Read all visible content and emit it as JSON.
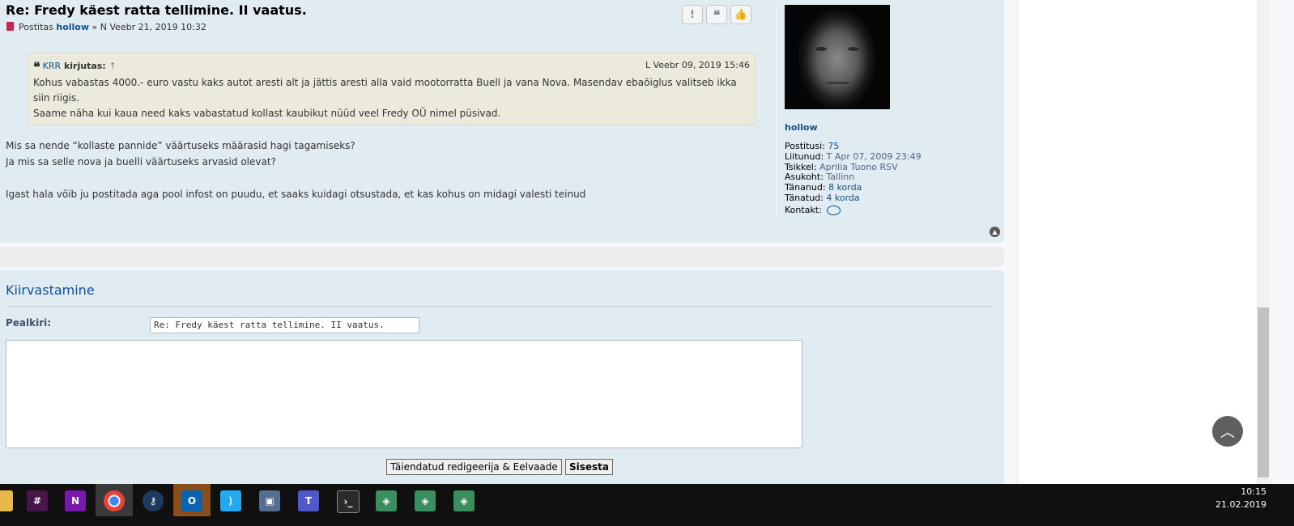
{
  "post": {
    "title": "Re: Fredy käest ratta tellimine. II vaatus.",
    "meta_prefix": "Postitas",
    "author": "hollow",
    "meta_suffix": "» N Veebr 21, 2019 10:32",
    "actions": [
      "!",
      "❝",
      "👍"
    ],
    "quote": {
      "author": "KRR",
      "written": "kirjutas:",
      "arrow": "↑",
      "date": "L Veebr 09, 2019 15:46",
      "line1": "Kohus vabastas 4000.- euro vastu kaks autot aresti alt ja jättis aresti alla vaid mootorratta Buell ja vana Nova. Masendav ebaõiglus valitseb ikka siin riigis.",
      "line2": "Saame näha kui kaua need kaks vabastatud kollast kaubikut nüüd veel Fredy OÜ nimel püsivad."
    },
    "body_line1": "Mis sa nende “kollaste pannide” väärtuseks määrasid hagi tagamiseks?",
    "body_line2": "Ja mis sa selle nova ja buelli väärtuseks arvasid olevat?",
    "body_line3": "Igast hala võib ju postitada aga pool infost on puudu, et saaks kuidagi otsustada, et kas kohus on midagi valesti teinud"
  },
  "profile": {
    "username": "hollow",
    "posts_label": "Postitusi:",
    "posts_value": "75",
    "joined_label": "Liitunud:",
    "joined_value": "T Apr 07, 2009 23:49",
    "bike_label": "Tsikkel:",
    "bike_value": "Aprilia Tuono RSV",
    "location_label": "Asukoht:",
    "location_value": "Tallinn",
    "thanked_label": "Tänanud:",
    "thanked_value": "8 korda",
    "been_thanked_label": "Tänatud:",
    "been_thanked_value": "4 korda",
    "contact_label": "Kontakt:"
  },
  "reply": {
    "title": "Kiirvastamine",
    "subject_label": "Pealkiri:",
    "subject_value": "Re: Fredy käest ratta tellimine. II vaatus.",
    "advanced_button": "Täiendatud redigeerija & Eelvaade",
    "submit_button": "Sisesta"
  },
  "taskbar": {
    "time": "10:15",
    "date": "21.02.2019"
  }
}
